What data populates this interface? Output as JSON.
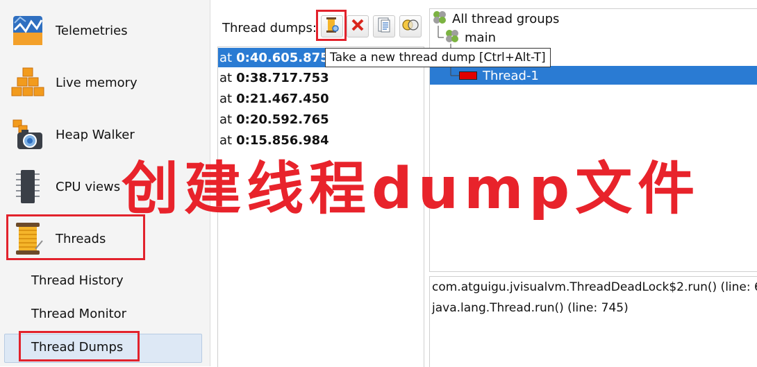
{
  "sidebar": {
    "items": [
      {
        "label": "Telemetries",
        "icon": "telemetry-chart-icon"
      },
      {
        "label": "Live memory",
        "icon": "memory-blocks-icon"
      },
      {
        "label": "Heap Walker",
        "icon": "heap-camera-icon"
      },
      {
        "label": "CPU views",
        "icon": "cpu-chip-icon"
      },
      {
        "label": "Threads",
        "icon": "thread-spool-icon"
      }
    ],
    "subitems": [
      {
        "label": "Thread History"
      },
      {
        "label": "Thread Monitor"
      },
      {
        "label": "Thread Dumps"
      }
    ]
  },
  "toolbar": {
    "label": "Thread dumps:",
    "tooltip": "Take a new thread dump [Ctrl+Alt-T]"
  },
  "dumps": [
    {
      "prefix": "at",
      "time": "0:40.605.875"
    },
    {
      "prefix": "at",
      "time": "0:38.717.753"
    },
    {
      "prefix": "at",
      "time": "0:21.467.450"
    },
    {
      "prefix": "at",
      "time": "0:20.592.765"
    },
    {
      "prefix": "at",
      "time": "0:15.856.984"
    }
  ],
  "tree": {
    "root": "All thread groups",
    "group": "main",
    "thread": "Thread-1"
  },
  "stack": [
    "com.atguigu.jvisualvm.ThreadDeadLock$2.run() (line: 6",
    "java.lang.Thread.run() (line: 745)"
  ],
  "overlay_text": "创建线程dump文件",
  "colors": {
    "accent": "#2a7bd3",
    "annotation": "#e2222c"
  }
}
